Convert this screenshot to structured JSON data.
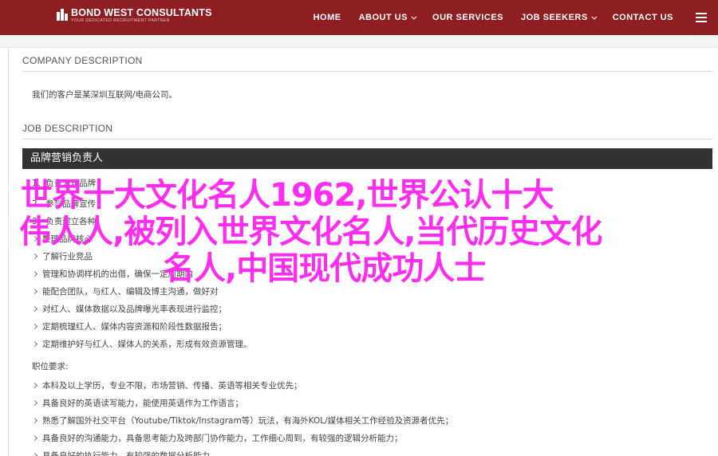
{
  "brand": {
    "name": "BOND WEST CONSULTANTS",
    "tagline": "YOUR DEDICATED RECRUITMENT PARTNER",
    "brand_color": "#8e1e21",
    "logo_icon": "building-logo-icon"
  },
  "nav": {
    "items": [
      {
        "label": "HOME"
      },
      {
        "label": "ABOUT US",
        "dropdown": true
      },
      {
        "label": "OUR SERVICES"
      },
      {
        "label": "JOB SEEKERS",
        "dropdown": true
      },
      {
        "label": "CONTACT US"
      }
    ],
    "menu_icon": "hamburger-menu-icon"
  },
  "company": {
    "heading": "COMPANY DESCRIPTION",
    "text": "我们的客户是某深圳互联网/电商公司。"
  },
  "job": {
    "heading": "JOB DESCRIPTION",
    "title": "品牌营销负责人",
    "intro_lines": [
      "1、负责公司品牌",
      "2、参与品牌宣传",
      "3、负责建立各种"
    ],
    "bullets": [
      "整理品牌核心",
      "了解行业竞品",
      "管理和协调样机的出借，确保一定周期内",
      "能配合团队，与红人、编辑及博主沟通，做好对",
      "对红人、媒体数据以及品牌曝光率表现进行监控；",
      "定期梳理红人、媒体内容资源和阶段性数据报告；",
      "定期维护好与红人、媒体人的关系，形成有效资源管理。"
    ],
    "requirements_heading": "职位要求:",
    "requirements": [
      "本科及以上学历，专业不限，市场营销、传播、英语等相关专业优先；",
      "具备良好的英语读写能力，能使用英语作为工作语言；",
      "熟悉了解国外社交平台（Youtube/Tiktok/Instagram等）玩法，有海外KOL/媒体相关工作经验及资源者优先；",
      "具备良好的沟通能力，具备思考能力及跨部门协作能力，工作细心周到，有较强的逻辑分析能力；",
      "具备良好的执行能力，有较强的数据分析能力，"
    ]
  },
  "overlay": {
    "color": "#ff2df0",
    "lines": [
      "世界十大文化名人1962,世界公认十大",
      "伟人人,被列入世界文化名人,当代历史文化",
      "名人,中国现代成功人士"
    ]
  }
}
